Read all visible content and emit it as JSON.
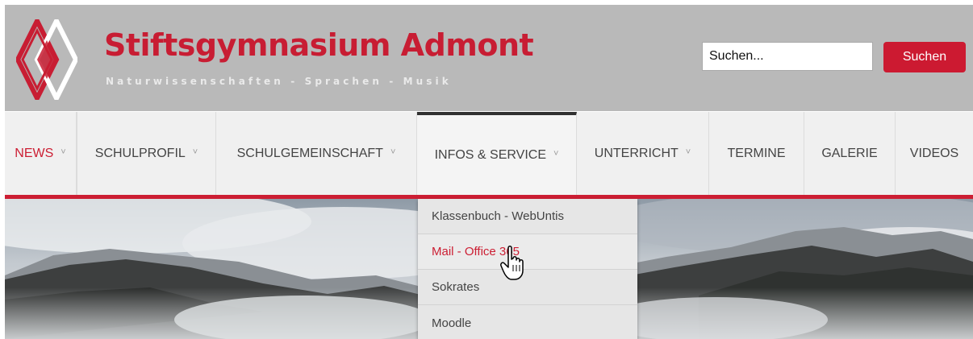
{
  "header": {
    "title": "Stiftsgymnasium Admont",
    "subtitle": "Naturwissenschaften - Sprachen - Musik",
    "brand_color": "#cc1e33",
    "logo_icon": "admont-diamond-logo"
  },
  "search": {
    "placeholder": "Suchen...",
    "button_label": "Suchen"
  },
  "nav": {
    "items": [
      {
        "label": "NEWS",
        "has_submenu": true,
        "state": "current"
      },
      {
        "label": "SCHULPROFIL",
        "has_submenu": true
      },
      {
        "label": "SCHULGEMEINSCHAFT",
        "has_submenu": true
      },
      {
        "label": "INFOS & SERVICE",
        "has_submenu": true,
        "state": "open"
      },
      {
        "label": "UNTERRICHT",
        "has_submenu": true
      },
      {
        "label": "TERMINE",
        "has_submenu": false
      },
      {
        "label": "GALERIE",
        "has_submenu": false
      },
      {
        "label": "VIDEOS",
        "has_submenu": false
      }
    ],
    "submenu_caret": "˅"
  },
  "dropdown": {
    "items": [
      {
        "label": "Klassenbuch - WebUntis"
      },
      {
        "label": "Mail - Office 365",
        "state": "hover"
      },
      {
        "label": "Sokrates"
      },
      {
        "label": "Moodle"
      }
    ]
  },
  "hero": {
    "description_icon": "mountain-landscape-photo"
  },
  "cursor": {
    "icon": "hand-pointer-icon"
  }
}
